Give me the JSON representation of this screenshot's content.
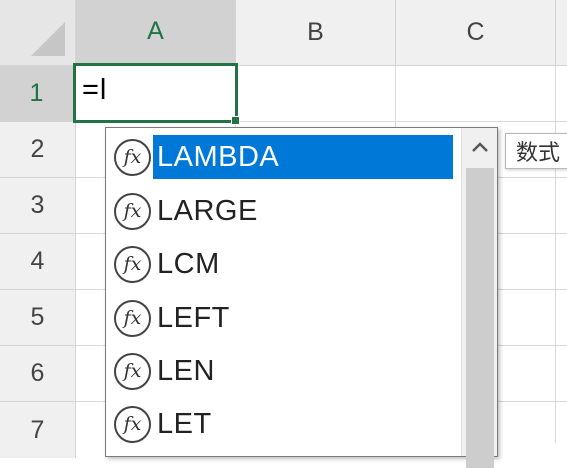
{
  "sheet": {
    "columns": [
      "A",
      "B",
      "C"
    ],
    "rows": [
      "1",
      "2",
      "3",
      "4",
      "5",
      "6",
      "7"
    ],
    "active_cell": "A1",
    "cell_input": "=l"
  },
  "autocomplete": {
    "items": [
      {
        "label": "LAMBDA",
        "icon": "function-icon",
        "selected": true
      },
      {
        "label": "LARGE",
        "icon": "function-icon",
        "selected": false
      },
      {
        "label": "LCM",
        "icon": "function-icon",
        "selected": false
      },
      {
        "label": "LEFT",
        "icon": "function-icon",
        "selected": false
      },
      {
        "label": "LEN",
        "icon": "function-icon",
        "selected": false
      },
      {
        "label": "LET",
        "icon": "function-icon",
        "selected": false
      }
    ],
    "icon_glyph": "fx",
    "scroll_up_glyph": "⌃",
    "selection_color": "#0078d7"
  },
  "tooltip": {
    "text": "数式"
  },
  "colors": {
    "accent": "#217346"
  }
}
